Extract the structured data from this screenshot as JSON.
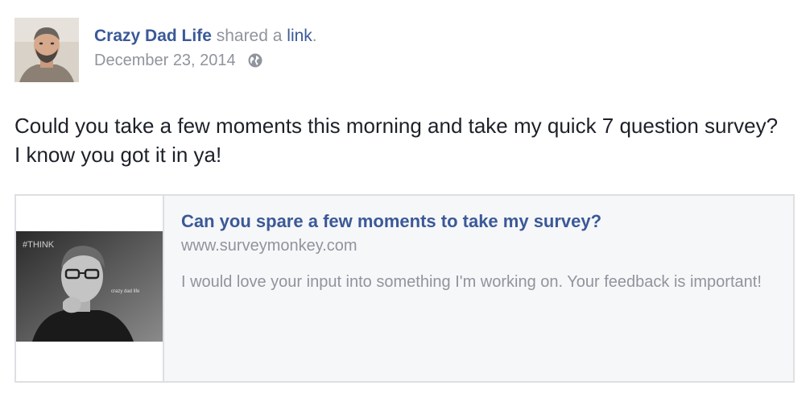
{
  "header": {
    "author_name": "Crazy Dad Life",
    "shared_text": " shared a ",
    "link_word": "link",
    "period": ".",
    "timestamp": "December 23, 2014",
    "privacy_icon": "globe-icon"
  },
  "post": {
    "text": "Could you take a few moments this morning and take my quick 7 question survey? I know you got it in ya!"
  },
  "link_preview": {
    "image_overlay_text": "#THINK",
    "image_caption": "crazy dad life",
    "title": "Can you spare a few moments to take my survey?",
    "domain": "www.surveymonkey.com",
    "description": "I would love your input into something I'm working on. Your feedback is important!"
  },
  "colors": {
    "link_blue": "#3b5998",
    "meta_gray": "#90949c",
    "card_background": "#f6f7f9",
    "card_border": "#dddfe2"
  }
}
